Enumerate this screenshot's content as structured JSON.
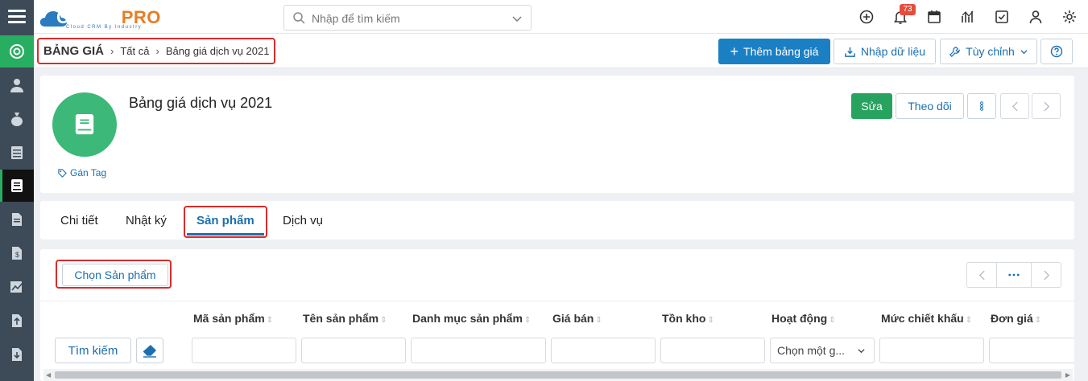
{
  "app": {
    "logo_word_a": "CLOUD",
    "logo_word_b": "PRO",
    "logo_tagline": "Cloud CRM By Industry"
  },
  "search": {
    "placeholder": "Nhập để tìm kiếm"
  },
  "notifications": {
    "count": "73"
  },
  "breadcrumb": {
    "root": "BẢNG GIÁ",
    "items": [
      "Tất cả",
      "Bảng giá dịch vụ 2021"
    ]
  },
  "toolbar": {
    "add_label": "Thêm bảng giá",
    "import_label": "Nhập dữ liệu",
    "customize_label": "Tùy chỉnh"
  },
  "record": {
    "title": "Bảng giá dịch vụ 2021",
    "tag_label": "Gán Tag",
    "edit_label": "Sửa",
    "follow_label": "Theo dõi"
  },
  "tabs": [
    {
      "label": "Chi tiết"
    },
    {
      "label": "Nhật ký"
    },
    {
      "label": "Sản phẩm"
    },
    {
      "label": "Dịch vụ"
    }
  ],
  "products": {
    "choose_label": "Chọn Sản phẩm",
    "search_label": "Tìm kiếm",
    "columns": [
      "Mã sản phẩm",
      "Tên sản phẩm",
      "Danh mục sản phẩm",
      "Giá bán",
      "Tồn kho",
      "Hoạt động",
      "Mức chiết khấu",
      "Đơn giá"
    ],
    "select_placeholder": "Chọn một g..."
  },
  "colors": {
    "accent": "#1b7fc4",
    "green": "#27a35f",
    "highlight": "#d92b2b",
    "rail": "#3d4a57"
  }
}
